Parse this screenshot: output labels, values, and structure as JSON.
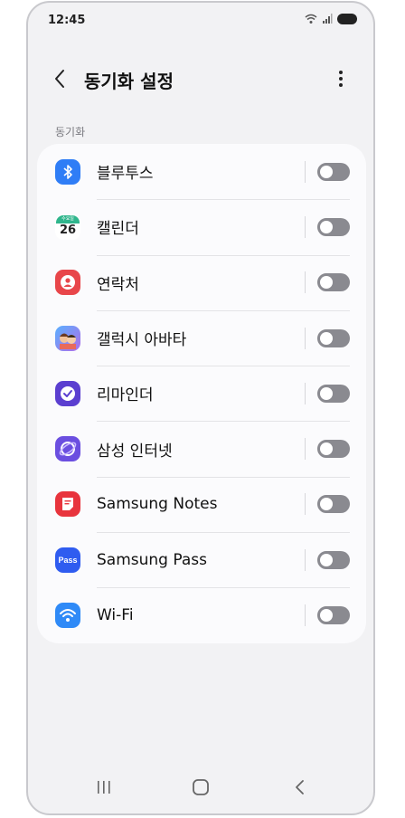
{
  "status": {
    "time": "12:45"
  },
  "header": {
    "title": "동기화 설정"
  },
  "section": {
    "label": "동기화"
  },
  "items": [
    {
      "label": "블루투스",
      "icon": "bluetooth-icon",
      "enabled": false
    },
    {
      "label": "캘린더",
      "icon": "calendar-icon",
      "enabled": false,
      "icon_text_top": "수요일",
      "icon_text_day": "26"
    },
    {
      "label": "연락처",
      "icon": "contacts-icon",
      "enabled": false
    },
    {
      "label": "갤럭시 아바타",
      "icon": "galaxy-avatar-icon",
      "enabled": false
    },
    {
      "label": "리마인더",
      "icon": "reminder-icon",
      "enabled": false
    },
    {
      "label": "삼성 인터넷",
      "icon": "samsung-internet-icon",
      "enabled": false
    },
    {
      "label": "Samsung Notes",
      "icon": "samsung-notes-icon",
      "enabled": false
    },
    {
      "label": "Samsung Pass",
      "icon": "samsung-pass-icon",
      "enabled": false,
      "icon_text": "Pass"
    },
    {
      "label": "Wi-Fi",
      "icon": "wifi-icon",
      "enabled": false
    }
  ],
  "colors": {
    "bluetooth": "#2f7df6",
    "contacts": "#e8464a",
    "reminder": "#5b3fd0",
    "internet": "#6b4fe0",
    "notes": "#e8343d",
    "pass": "#2f5cf0",
    "wifi": "#2f8af7",
    "toggle_off": "#8a8a90"
  }
}
